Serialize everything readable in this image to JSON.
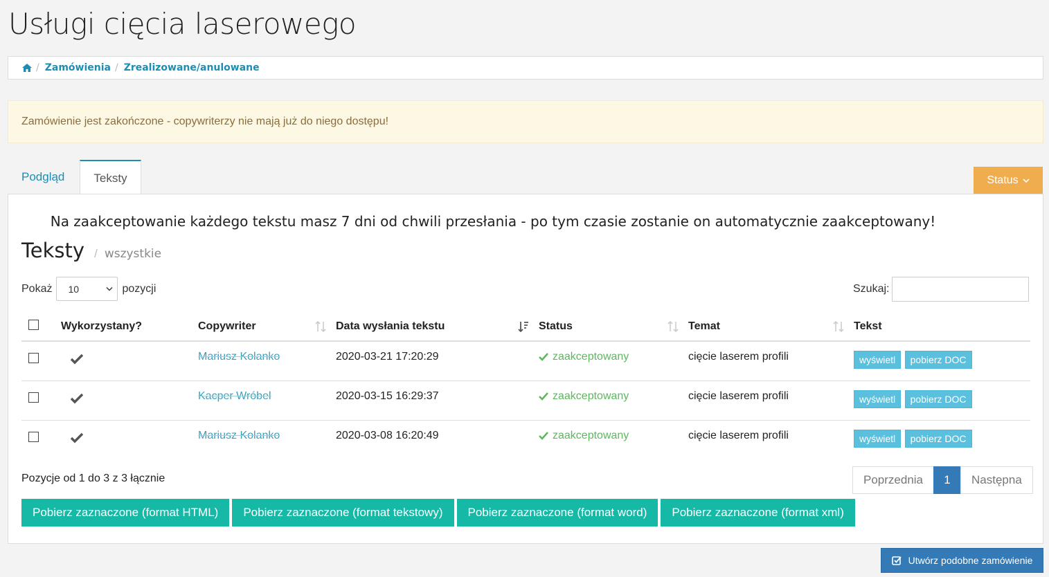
{
  "page": {
    "title": "Usługi cięcia laserowego"
  },
  "breadcrumb": {
    "items": [
      "Zamówienia",
      "Zrealizowane/anulowane"
    ]
  },
  "alert": {
    "text": "Zamówienie jest zakończone - copywriterzy nie mają już do niego dostępu!"
  },
  "tabs": [
    {
      "label": "Podgląd"
    },
    {
      "label": "Teksty"
    }
  ],
  "status_button": {
    "label": "Status"
  },
  "notice": "Na zaakceptowanie każdego tekstu masz 7 dni od chwili przesłania - po tym czasie zostanie on automatycznie zaakceptowany!",
  "section": {
    "title": "Teksty",
    "subtitle": "wszystkie"
  },
  "controls": {
    "show_label": "Pokaż",
    "show_value": "10",
    "show_suffix": "pozycji",
    "search_label": "Szukaj:"
  },
  "table": {
    "headers": [
      "Wykorzystany?",
      "Copywriter",
      "Data wysłania tekstu",
      "Status",
      "Temat",
      "Tekst"
    ],
    "rows": [
      {
        "copywriter": "Mariusz Kolanko",
        "date": "2020-03-21 17:20:29",
        "status": "zaakceptowany",
        "topic": "cięcie laserem profili"
      },
      {
        "copywriter": "Kacper Wróbel",
        "date": "2020-03-15 16:29:37",
        "status": "zaakceptowany",
        "topic": "cięcie laserem profili"
      },
      {
        "copywriter": "Mariusz Kolanko",
        "date": "2020-03-08 16:20:49",
        "status": "zaakceptowany",
        "topic": "cięcie laserem profili"
      }
    ],
    "view_label": "wyświetl",
    "download_label": "pobierz DOC"
  },
  "info": "Pozycje od 1 do 3 z 3 łącznie",
  "pagination": {
    "prev": "Poprzednia",
    "current": "1",
    "next": "Następna"
  },
  "downloads": [
    "Pobierz zaznaczone (format HTML)",
    "Pobierz zaznaczone (format tekstowy)",
    "Pobierz zaznaczone (format word)",
    "Pobierz zaznaczone (format xml)"
  ],
  "create_button": {
    "label": "Utwórz podobne zamówienie"
  },
  "colors": {
    "link": "#1c8db3",
    "warning": "#f0ad4e",
    "primary": "#337ab7",
    "teal": "#16b8a6",
    "info": "#5bc0de",
    "success": "#5cb85c"
  }
}
